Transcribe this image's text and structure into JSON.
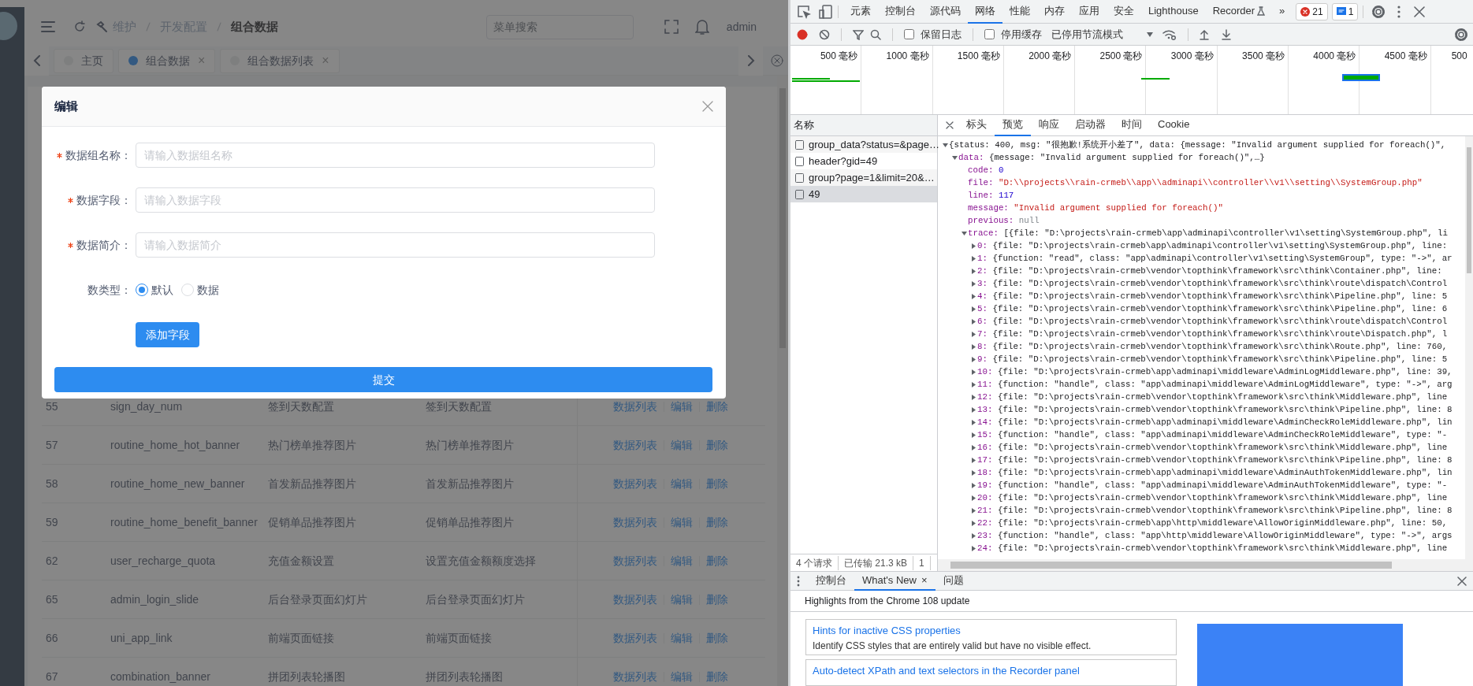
{
  "app": {
    "header": {
      "breadcrumb": [
        {
          "label": "维护",
          "current": false
        },
        {
          "label": "开发配置",
          "current": false
        },
        {
          "label": "组合数据",
          "current": true
        }
      ],
      "search": {
        "placeholder": "菜单搜索"
      },
      "user": "admin"
    },
    "tabs": [
      {
        "label": "主页",
        "selected": false
      },
      {
        "label": "组合数据",
        "selected": true,
        "close": "×"
      },
      {
        "label": "组合数据列表",
        "selected": false,
        "close": "×"
      }
    ],
    "table": {
      "rows": [
        {
          "id": "55",
          "key": "sign_day_num",
          "name": "签到天数配置",
          "info": "签到天数配置",
          "actions": [
            "数据列表",
            "编辑",
            "删除"
          ]
        },
        {
          "id": "57",
          "key": "routine_home_hot_banner",
          "name": "热门榜单推荐图片",
          "info": "热门榜单推荐图片",
          "actions": [
            "数据列表",
            "编辑",
            "删除"
          ]
        },
        {
          "id": "58",
          "key": "routine_home_new_banner",
          "name": "首发新品推荐图片",
          "info": "首发新品推荐图片",
          "actions": [
            "数据列表",
            "编辑",
            "删除"
          ]
        },
        {
          "id": "59",
          "key": "routine_home_benefit_banner",
          "name": "促销单品推荐图片",
          "info": "促销单品推荐图片",
          "actions": [
            "数据列表",
            "编辑",
            "删除"
          ]
        },
        {
          "id": "62",
          "key": "user_recharge_quota",
          "name": "充值金额设置",
          "info": "设置充值金额额度选择",
          "actions": [
            "数据列表",
            "编辑",
            "删除"
          ]
        },
        {
          "id": "65",
          "key": "admin_login_slide",
          "name": "后台登录页面幻灯片",
          "info": "后台登录页面幻灯片",
          "actions": [
            "数据列表",
            "编辑",
            "删除"
          ]
        },
        {
          "id": "66",
          "key": "uni_app_link",
          "name": "前端页面链接",
          "info": "前端页面链接",
          "actions": [
            "数据列表",
            "编辑",
            "删除"
          ]
        },
        {
          "id": "67",
          "key": "combination_banner",
          "name": "拼团列表轮播图",
          "info": "拼团列表轮播图",
          "actions": [
            "数据列表",
            "编辑",
            "删除"
          ]
        }
      ]
    }
  },
  "modal": {
    "title": "编辑",
    "fields": [
      {
        "kind": "input",
        "label": "数据组名称：",
        "required": true,
        "placeholder": "请输入数据组名称"
      },
      {
        "kind": "input",
        "label": "数据字段：",
        "required": true,
        "placeholder": "请输入数据字段"
      },
      {
        "kind": "input",
        "label": "数据简介：",
        "required": true,
        "placeholder": "请输入数据简介"
      },
      {
        "kind": "radio",
        "label": "数类型：",
        "required": false,
        "options": [
          {
            "label": "默认",
            "selected": true
          },
          {
            "label": "数据",
            "selected": false
          }
        ]
      }
    ],
    "add_button": "添加字段",
    "submit_button": "提交"
  },
  "devtools": {
    "tabs": [
      {
        "label": "元素",
        "selected": false,
        "experimental": false
      },
      {
        "label": "控制台",
        "selected": false,
        "experimental": false
      },
      {
        "label": "源代码",
        "selected": false,
        "experimental": false
      },
      {
        "label": "网络",
        "selected": true,
        "experimental": false
      },
      {
        "label": "性能",
        "selected": false,
        "experimental": false
      },
      {
        "label": "内存",
        "selected": false,
        "experimental": false
      },
      {
        "label": "应用",
        "selected": false,
        "experimental": false
      },
      {
        "label": "安全",
        "selected": false,
        "experimental": false
      },
      {
        "label": "Lighthouse",
        "selected": false,
        "experimental": false
      },
      {
        "label": "Recorder",
        "selected": false,
        "experimental": true
      }
    ],
    "more": "»",
    "errors": "21",
    "messages": "1",
    "toolbar": {
      "recording": true,
      "checkboxes": [
        {
          "label": "保留日志",
          "checked": false
        },
        {
          "label": "停用缓存",
          "checked": false
        }
      ],
      "throttle": "已停用节流模式"
    },
    "timeline": {
      "ticks": [
        "500 毫秒",
        "1000 毫秒",
        "1500 毫秒",
        "2000 毫秒",
        "2500 毫秒",
        "3000 毫秒",
        "3500 毫秒",
        "4000 毫秒",
        "4500 毫秒",
        "500"
      ]
    },
    "requests": {
      "header": "名称",
      "items": [
        {
          "name": "group_data?status=&page…",
          "selected": false
        },
        {
          "name": "header?gid=49",
          "selected": false
        },
        {
          "name": "group?page=1&limit=20&…",
          "selected": false
        },
        {
          "name": "49",
          "selected": true
        }
      ],
      "status": [
        "4 个请求",
        "已传输 21.3 kB",
        "1"
      ]
    },
    "detail": {
      "tabs": [
        {
          "label": "标头",
          "selected": false
        },
        {
          "label": "预览",
          "selected": true
        },
        {
          "label": "响应",
          "selected": false
        },
        {
          "label": "启动器",
          "selected": false
        },
        {
          "label": "时间",
          "selected": false
        },
        {
          "label": "Cookie",
          "selected": false
        }
      ],
      "preview": {
        "value": "{status: 400, msg: \"很抱歉!系统开小差了\", data: {message: \"Invalid argument supplied for foreach()\",",
        "kind": "object",
        "expanded": true,
        "children": [
          {
            "key": "data:",
            "value": "{message: \"Invalid argument supplied for foreach()\",…}",
            "kind": "object",
            "expanded": true,
            "children": [
              {
                "key": "code:",
                "value": "0",
                "kind": "number"
              },
              {
                "key": "file:",
                "value": "\"D:\\\\projects\\\\rain-crmeb\\\\app\\\\adminapi\\\\controller\\\\v1\\\\setting\\\\SystemGroup.php\"",
                "kind": "string"
              },
              {
                "key": "line:",
                "value": "117",
                "kind": "number"
              },
              {
                "key": "message:",
                "value": "\"Invalid argument supplied for foreach()\"",
                "kind": "string"
              },
              {
                "key": "previous:",
                "value": "null",
                "kind": "null"
              },
              {
                "key": "trace:",
                "value": "[{file: \"D:\\projects\\rain-crmeb\\app\\adminapi\\controller\\v1\\setting\\SystemGroup.php\", li",
                "kind": "object",
                "expanded": true,
                "children": [
                  {
                    "key": "0:",
                    "value": "{file: \"D:\\projects\\rain-crmeb\\app\\adminapi\\controller\\v1\\setting\\SystemGroup.php\", line:",
                    "kind": "object",
                    "expanded": false
                  },
                  {
                    "key": "1:",
                    "value": "{function: \"read\", class: \"app\\adminapi\\controller\\v1\\setting\\SystemGroup\", type: \"->\", ar",
                    "kind": "object",
                    "expanded": false
                  },
                  {
                    "key": "2:",
                    "value": "{file: \"D:\\projects\\rain-crmeb\\vendor\\topthink\\framework\\src\\think\\Container.php\", line:",
                    "kind": "object",
                    "expanded": false
                  },
                  {
                    "key": "3:",
                    "value": "{file: \"D:\\projects\\rain-crmeb\\vendor\\topthink\\framework\\src\\think\\route\\dispatch\\Control",
                    "kind": "object",
                    "expanded": false
                  },
                  {
                    "key": "4:",
                    "value": "{file: \"D:\\projects\\rain-crmeb\\vendor\\topthink\\framework\\src\\think\\Pipeline.php\", line: 5",
                    "kind": "object",
                    "expanded": false
                  },
                  {
                    "key": "5:",
                    "value": "{file: \"D:\\projects\\rain-crmeb\\vendor\\topthink\\framework\\src\\think\\Pipeline.php\", line: 6",
                    "kind": "object",
                    "expanded": false
                  },
                  {
                    "key": "6:",
                    "value": "{file: \"D:\\projects\\rain-crmeb\\vendor\\topthink\\framework\\src\\think\\route\\dispatch\\Control",
                    "kind": "object",
                    "expanded": false
                  },
                  {
                    "key": "7:",
                    "value": "{file: \"D:\\projects\\rain-crmeb\\vendor\\topthink\\framework\\src\\think\\route\\Dispatch.php\", l",
                    "kind": "object",
                    "expanded": false
                  },
                  {
                    "key": "8:",
                    "value": "{file: \"D:\\projects\\rain-crmeb\\vendor\\topthink\\framework\\src\\think\\Route.php\", line: 760,",
                    "kind": "object",
                    "expanded": false
                  },
                  {
                    "key": "9:",
                    "value": "{file: \"D:\\projects\\rain-crmeb\\vendor\\topthink\\framework\\src\\think\\Pipeline.php\", line: 5",
                    "kind": "object",
                    "expanded": false
                  },
                  {
                    "key": "10:",
                    "value": "{file: \"D:\\projects\\rain-crmeb\\app\\adminapi\\middleware\\AdminLogMiddleware.php\", line: 39,",
                    "kind": "object",
                    "expanded": false
                  },
                  {
                    "key": "11:",
                    "value": "{function: \"handle\", class: \"app\\adminapi\\middleware\\AdminLogMiddleware\", type: \"->\", arg",
                    "kind": "object",
                    "expanded": false
                  },
                  {
                    "key": "12:",
                    "value": "{file: \"D:\\projects\\rain-crmeb\\vendor\\topthink\\framework\\src\\think\\Middleware.php\", line",
                    "kind": "object",
                    "expanded": false
                  },
                  {
                    "key": "13:",
                    "value": "{file: \"D:\\projects\\rain-crmeb\\vendor\\topthink\\framework\\src\\think\\Pipeline.php\", line: 8",
                    "kind": "object",
                    "expanded": false
                  },
                  {
                    "key": "14:",
                    "value": "{file: \"D:\\projects\\rain-crmeb\\app\\adminapi\\middleware\\AdminCheckRoleMiddleware.php\", lin",
                    "kind": "object",
                    "expanded": false
                  },
                  {
                    "key": "15:",
                    "value": "{function: \"handle\", class: \"app\\adminapi\\middleware\\AdminCheckRoleMiddleware\", type: \"-",
                    "kind": "object",
                    "expanded": false
                  },
                  {
                    "key": "16:",
                    "value": "{file: \"D:\\projects\\rain-crmeb\\vendor\\topthink\\framework\\src\\think\\Middleware.php\", line",
                    "kind": "object",
                    "expanded": false
                  },
                  {
                    "key": "17:",
                    "value": "{file: \"D:\\projects\\rain-crmeb\\vendor\\topthink\\framework\\src\\think\\Pipeline.php\", line: 8",
                    "kind": "object",
                    "expanded": false
                  },
                  {
                    "key": "18:",
                    "value": "{file: \"D:\\projects\\rain-crmeb\\app\\adminapi\\middleware\\AdminAuthTokenMiddleware.php\", lin",
                    "kind": "object",
                    "expanded": false
                  },
                  {
                    "key": "19:",
                    "value": "{function: \"handle\", class: \"app\\adminapi\\middleware\\AdminAuthTokenMiddleware\", type: \"-",
                    "kind": "object",
                    "expanded": false
                  },
                  {
                    "key": "20:",
                    "value": "{file: \"D:\\projects\\rain-crmeb\\vendor\\topthink\\framework\\src\\think\\Middleware.php\", line",
                    "kind": "object",
                    "expanded": false
                  },
                  {
                    "key": "21:",
                    "value": "{file: \"D:\\projects\\rain-crmeb\\vendor\\topthink\\framework\\src\\think\\Pipeline.php\", line: 8",
                    "kind": "object",
                    "expanded": false
                  },
                  {
                    "key": "22:",
                    "value": "{file: \"D:\\projects\\rain-crmeb\\app\\http\\middleware\\AllowOriginMiddleware.php\", line: 50,",
                    "kind": "object",
                    "expanded": false
                  },
                  {
                    "key": "23:",
                    "value": "{function: \"handle\", class: \"app\\http\\middleware\\AllowOriginMiddleware\", type: \"->\", args",
                    "kind": "object",
                    "expanded": false
                  },
                  {
                    "key": "24:",
                    "value": "{file: \"D:\\projects\\rain-crmeb\\vendor\\topthink\\framework\\src\\think\\Middleware.php\", line",
                    "kind": "object",
                    "expanded": false
                  }
                ]
              }
            ]
          }
        ]
      }
    },
    "drawer": {
      "tabs": [
        {
          "label": "控制台",
          "selected": false
        },
        {
          "label": "What's New",
          "selected": true,
          "close": "×"
        },
        {
          "label": "问题",
          "selected": false
        }
      ],
      "heading": "Highlights from the Chrome 108 update",
      "cards": [
        {
          "title": "Hints for inactive CSS properties",
          "text": "Identify CSS styles that are entirely valid but have no visible effect."
        },
        {
          "title": "Auto-detect XPath and text selectors in the Recorder panel"
        }
      ]
    }
  }
}
